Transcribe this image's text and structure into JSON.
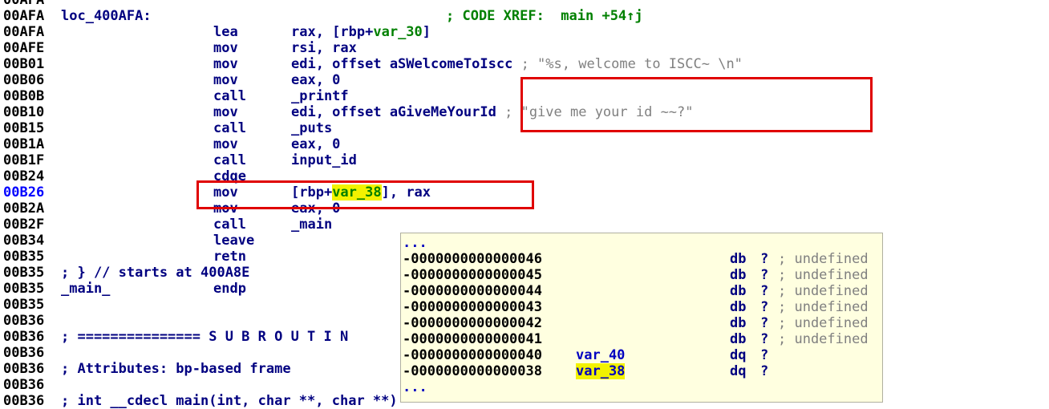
{
  "top_partial": "00AFA",
  "lines": [
    {
      "addr": "00AFA",
      "label": "loc_400AFA:",
      "xref": "; CODE XREF:  main +54↑j"
    },
    {
      "addr": "00AFA",
      "mnem": "lea",
      "ops_pre": "rax, [rbp+",
      "ops_var": "var_30",
      "ops_post": "]"
    },
    {
      "addr": "00AFE",
      "mnem": "mov",
      "ops": "rsi, rax"
    },
    {
      "addr": "00B01",
      "mnem": "mov",
      "ops": "edi, offset aSWelcomeToIscc",
      "comment": " ; \"%s, welcome to ISCC~ \\n\""
    },
    {
      "addr": "00B06",
      "mnem": "mov",
      "ops": "eax, 0"
    },
    {
      "addr": "00B0B",
      "mnem": "call",
      "ops": "_printf"
    },
    {
      "addr": "00B10",
      "mnem": "mov",
      "ops": "edi, offset aGiveMeYourId",
      "comment": " ; \"give me your id ~~?\""
    },
    {
      "addr": "00B15",
      "mnem": "call",
      "ops": "_puts"
    },
    {
      "addr": "00B1A",
      "mnem": "mov",
      "ops": "eax, 0"
    },
    {
      "addr": "00B1F",
      "mnem": "call",
      "ops": "input_id"
    },
    {
      "addr": "00B24",
      "mnem": "cdqe"
    },
    {
      "addr": "00B26",
      "mnem": "mov",
      "ops_pre": "[rbp+",
      "ops_var": "var_38",
      "ops_post": "], rax",
      "current": true
    },
    {
      "addr": "00B2A",
      "mnem": "mov",
      "ops": "eax, 0"
    },
    {
      "addr": "00B2F",
      "mnem": "call",
      "ops": "_main"
    },
    {
      "addr": "00B34",
      "mnem": "leave"
    },
    {
      "addr": "00B35",
      "mnem": "retn"
    },
    {
      "addr": "00B35",
      "label": "; } // starts at 400A8E"
    },
    {
      "addr": "00B35",
      "label": "_main_",
      "mnem": "endp"
    },
    {
      "addr": "00B35"
    },
    {
      "addr": "00B36"
    },
    {
      "addr": "00B36",
      "label": "; =============== S U B R O U T I N"
    },
    {
      "addr": "00B36"
    },
    {
      "addr": "00B36",
      "label": "; Attributes: bp-based frame"
    },
    {
      "addr": "00B36"
    },
    {
      "addr": "00B36",
      "label": "; int __cdecl main(int, char **, char **)"
    }
  ],
  "popup": {
    "header_dots": "...",
    "footer_dots": "...",
    "rows": [
      {
        "offset": "-0000000000000046",
        "var": "",
        "type": "db",
        "q": "?",
        "comment": "; undefined"
      },
      {
        "offset": "-0000000000000045",
        "var": "",
        "type": "db",
        "q": "?",
        "comment": "; undefined"
      },
      {
        "offset": "-0000000000000044",
        "var": "",
        "type": "db",
        "q": "?",
        "comment": "; undefined"
      },
      {
        "offset": "-0000000000000043",
        "var": "",
        "type": "db",
        "q": "?",
        "comment": "; undefined"
      },
      {
        "offset": "-0000000000000042",
        "var": "",
        "type": "db",
        "q": "?",
        "comment": "; undefined"
      },
      {
        "offset": "-0000000000000041",
        "var": "",
        "type": "db",
        "q": "?",
        "comment": "; undefined"
      },
      {
        "offset": "-0000000000000040",
        "var": "var_40",
        "type": "dq",
        "q": "?",
        "comment": ""
      },
      {
        "offset": "-0000000000000038",
        "var": "var_38",
        "type": "dq",
        "q": "?",
        "comment": "",
        "highlight": true
      }
    ]
  },
  "colors": {
    "accent_red": "#e00000",
    "highlight": "#f2f200",
    "popup_bg": "#ffffe0",
    "addr_current": "#0000ff"
  }
}
